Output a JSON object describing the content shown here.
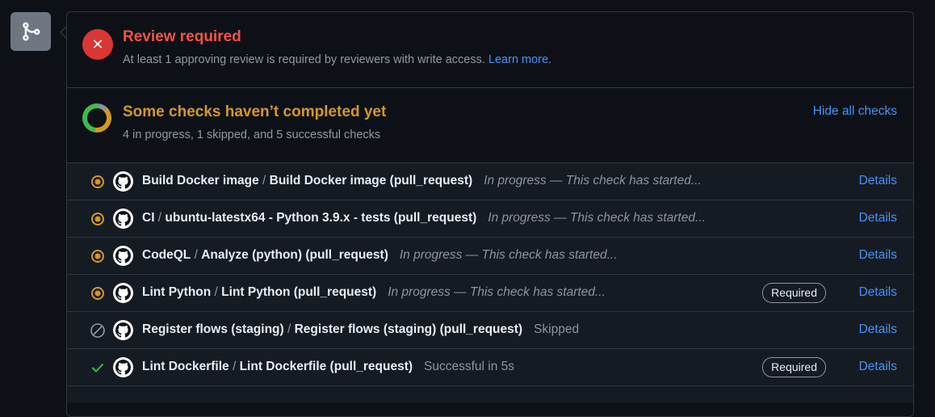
{
  "review": {
    "title": "Review required",
    "description": "At least 1 approving review is required by reviewers with write access.",
    "learn_more": "Learn more."
  },
  "checks": {
    "title": "Some checks haven’t completed yet",
    "summary": "4 in progress, 1 skipped, and 5 successful checks",
    "hide_label": "Hide all checks",
    "donut": {
      "success": 5,
      "in_progress": 4,
      "skipped": 1,
      "colors": {
        "success": "#3fb950",
        "in_progress": "#d29922",
        "skipped": "#8b949e"
      }
    }
  },
  "rows": [
    {
      "workflow": "Build Docker image",
      "job": "Build Docker image (pull_request)",
      "note": "In progress — This check has started...",
      "status": "in_progress",
      "required": "",
      "details": "Details"
    },
    {
      "workflow": "CI",
      "job": "ubuntu-latestx64 - Python 3.9.x - tests (pull_request)",
      "note": "In progress — This check has started...",
      "status": "in_progress",
      "required": "",
      "details": "Details"
    },
    {
      "workflow": "CodeQL",
      "job": "Analyze (python) (pull_request)",
      "note": "In progress — This check has started...",
      "status": "in_progress",
      "required": "",
      "details": "Details"
    },
    {
      "workflow": "Lint Python",
      "job": "Lint Python (pull_request)",
      "note": "In progress — This check has started...",
      "status": "in_progress",
      "required": "Required",
      "details": "Details"
    },
    {
      "workflow": "Register flows (staging)",
      "job": "Register flows (staging) (pull_request)",
      "note": "Skipped",
      "status": "skipped",
      "required": "",
      "details": "Details"
    },
    {
      "workflow": "Lint Dockerfile",
      "job": "Lint Dockerfile (pull_request)",
      "note": "Successful in 5s",
      "status": "success",
      "required": "Required",
      "details": "Details"
    }
  ],
  "icons": {
    "merge": "git-merge-icon",
    "review": "x-circle-icon",
    "in_progress": "dot-fill-icon",
    "skipped": "skip-icon",
    "success": "check-icon",
    "avatar": "github-logo-icon"
  }
}
